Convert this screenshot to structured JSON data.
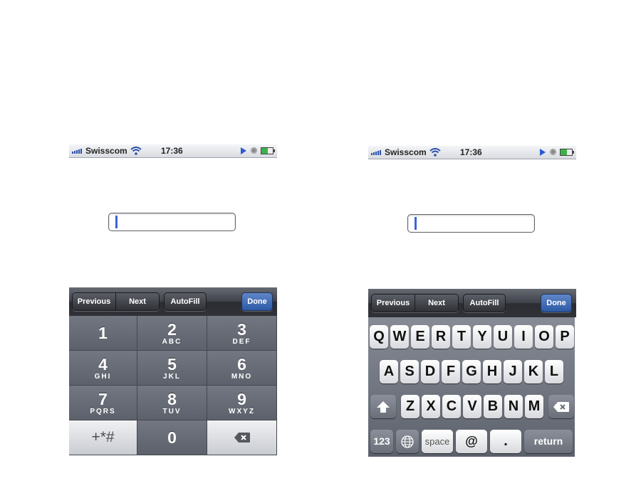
{
  "status_bar": {
    "carrier": "Swisscom",
    "time": "17:36"
  },
  "toolbar": {
    "previous": "Previous",
    "next": "Next",
    "autofill": "AutoFill",
    "done": "Done"
  },
  "numpad": {
    "keys": [
      {
        "num": "1",
        "letters": ""
      },
      {
        "num": "2",
        "letters": "ABC"
      },
      {
        "num": "3",
        "letters": "DEF"
      },
      {
        "num": "4",
        "letters": "GHI"
      },
      {
        "num": "5",
        "letters": "JKL"
      },
      {
        "num": "6",
        "letters": "MNO"
      },
      {
        "num": "7",
        "letters": "PQRS"
      },
      {
        "num": "8",
        "letters": "TUV"
      },
      {
        "num": "9",
        "letters": "WXYZ"
      },
      {
        "num": "+*#",
        "letters": ""
      },
      {
        "num": "0",
        "letters": ""
      }
    ]
  },
  "keyboard": {
    "row1": [
      "Q",
      "W",
      "E",
      "R",
      "T",
      "Y",
      "U",
      "I",
      "O",
      "P"
    ],
    "row2": [
      "A",
      "S",
      "D",
      "F",
      "G",
      "H",
      "J",
      "K",
      "L"
    ],
    "row3": [
      "Z",
      "X",
      "C",
      "V",
      "B",
      "N",
      "M"
    ],
    "numbers_key": "123",
    "space_key": "space",
    "at_key": "@",
    "dot_key": ".",
    "return_key": "return"
  }
}
